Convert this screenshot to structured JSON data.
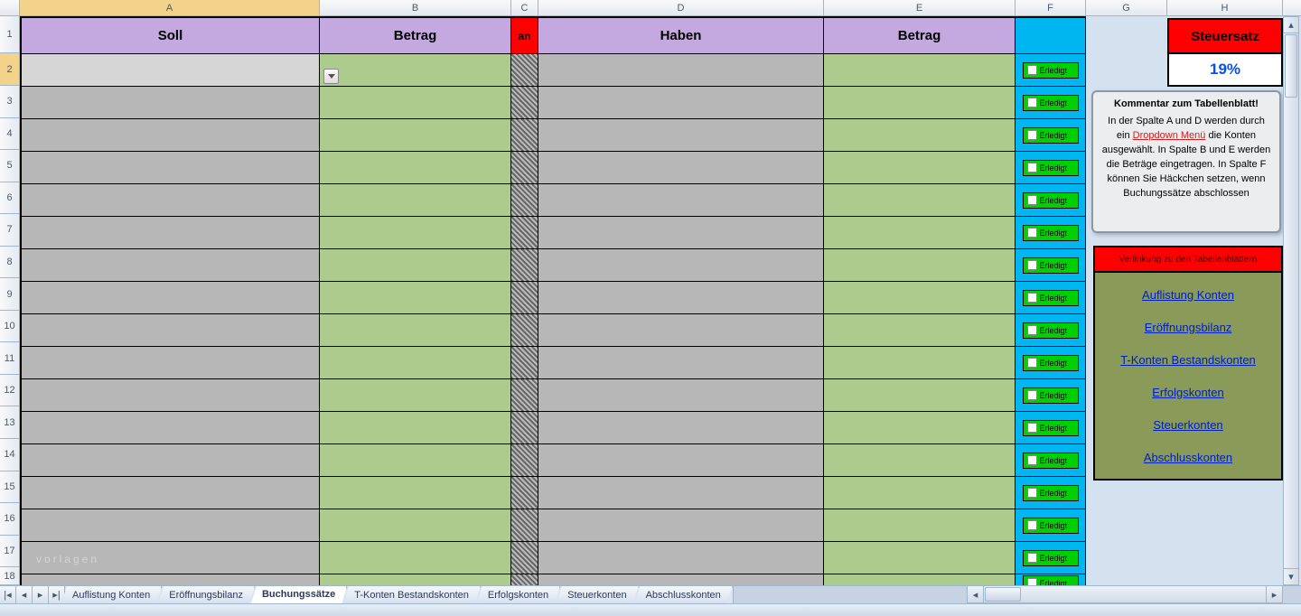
{
  "columns": [
    "A",
    "B",
    "C",
    "D",
    "E",
    "F",
    "G",
    "H"
  ],
  "rows": [
    1,
    2,
    3,
    4,
    5,
    6,
    7,
    8,
    9,
    10,
    11,
    12,
    13,
    14,
    15,
    16,
    17,
    18
  ],
  "headers": {
    "A": "Soll",
    "B": "Betrag",
    "C": "an",
    "D": "Haben",
    "E": "Betrag",
    "F": "",
    "H_steuersatz": "Steuersatz"
  },
  "steuersatz_value": "19%",
  "erledigt_label": "Erledigt",
  "comment": {
    "title": "Kommentar zum Tabellenblatt!",
    "line1": "In der Spalte A und D werden durch ein ",
    "dropdown": "Dropdown Menü",
    "line2": " die Konten ausgewählt. In Spalte B und E werden die Beträge eingetragen. In Spalte F können Sie Häckchen setzen, wenn Buchungssätze abschlossen"
  },
  "verlinkung_header": "Verlinkung zu den Tabellenblättern",
  "links": [
    "Auflistung Konten",
    "Eröffnungsbilanz",
    "T-Konten Bestandskonten",
    "Erfolgskonten",
    "Steuerkonten",
    "Abschlusskonten"
  ],
  "watermark": "vorlagen",
  "tabs": [
    "Auflistung Konten",
    "Eröffnungsbilanz",
    "Buchungssätze",
    "T-Konten Bestandskonten",
    "Erfolgskonten",
    "Steuerkonten",
    "Abschlusskonten"
  ],
  "active_tab": "Buchungssätze",
  "active_cell": {
    "row": 2,
    "col": "A"
  }
}
